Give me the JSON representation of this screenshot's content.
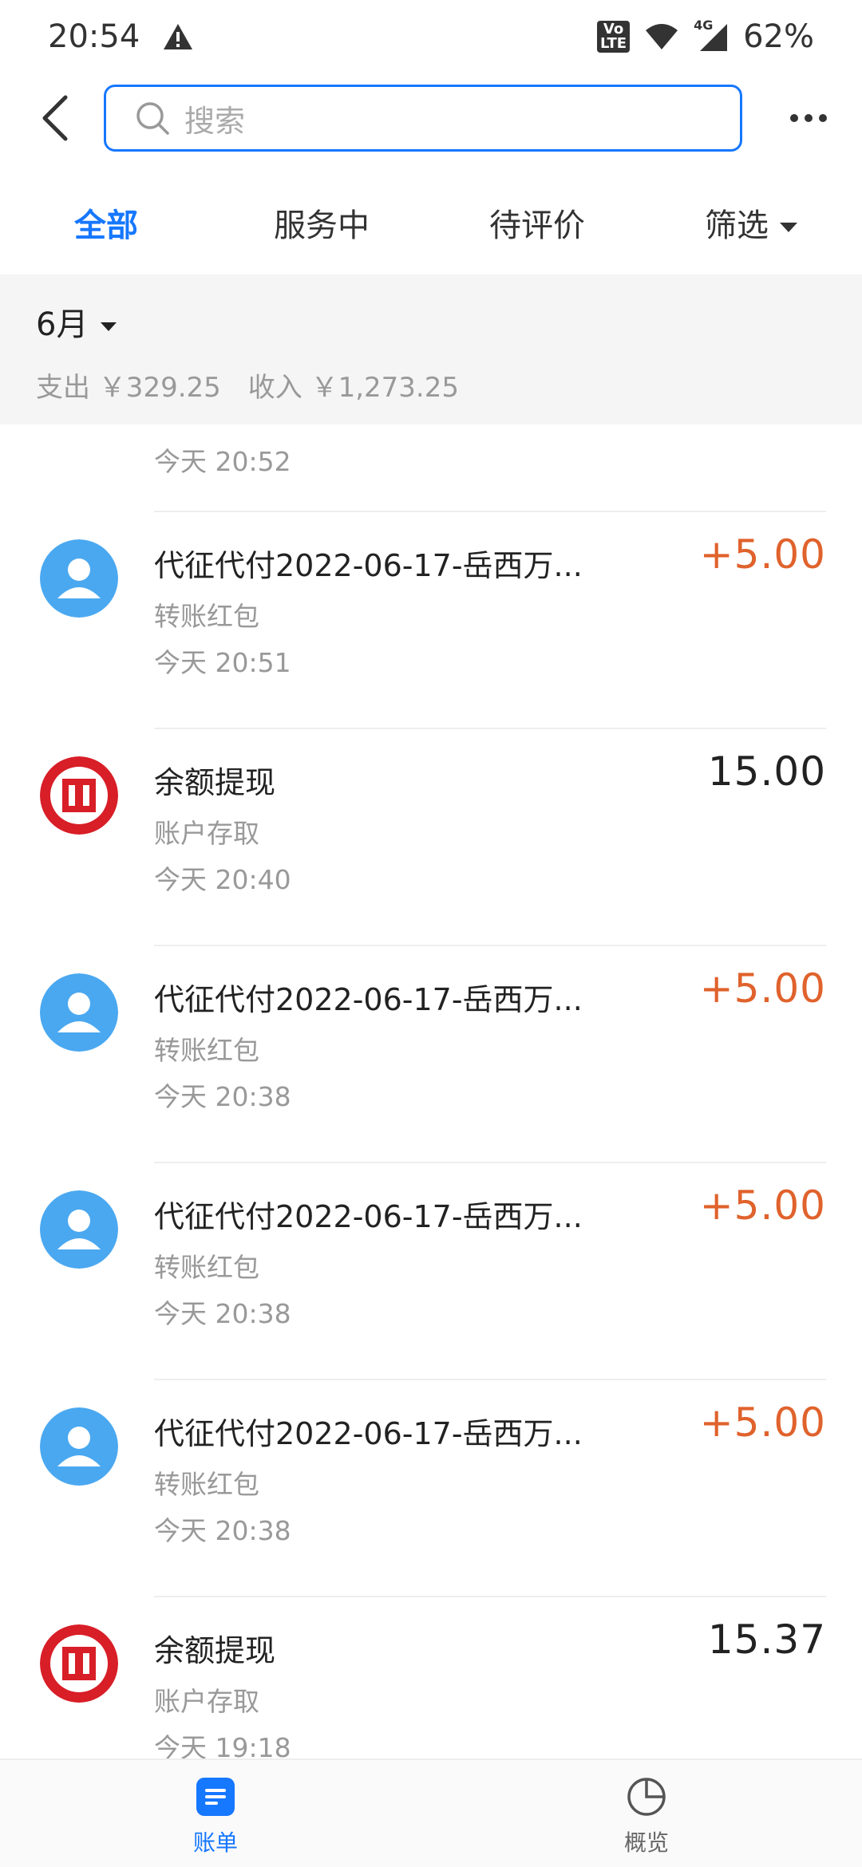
{
  "status_bar": {
    "time": "20:54",
    "volte_top": "Vo",
    "volte_bottom": "LTE",
    "network": "4G",
    "battery": "62%"
  },
  "search": {
    "placeholder": "搜索"
  },
  "tabs": [
    {
      "label": "全部",
      "active": true
    },
    {
      "label": "服务中",
      "active": false
    },
    {
      "label": "待评价",
      "active": false
    },
    {
      "label": "筛选",
      "active": false
    }
  ],
  "month": {
    "title": "6月",
    "expense": "支出 ￥329.25",
    "income": "收入 ￥1,273.25"
  },
  "partial_row_time": "今天  20:52",
  "transactions": [
    {
      "title": "代征代付2022-06-17-岳西万...",
      "subtitle": "转账红包",
      "time": "今天  20:51",
      "amount": "+5.00",
      "income": true,
      "icon": "person-avatar-icon"
    },
    {
      "title": "余额提现",
      "subtitle": "账户存取",
      "time": "今天  20:40",
      "amount": "15.00",
      "income": false,
      "icon": "icbc-bank-icon"
    },
    {
      "title": "代征代付2022-06-17-岳西万...",
      "subtitle": "转账红包",
      "time": "今天  20:38",
      "amount": "+5.00",
      "income": true,
      "icon": "person-avatar-icon"
    },
    {
      "title": "代征代付2022-06-17-岳西万...",
      "subtitle": "转账红包",
      "time": "今天  20:38",
      "amount": "+5.00",
      "income": true,
      "icon": "person-avatar-icon"
    },
    {
      "title": "代征代付2022-06-17-岳西万...",
      "subtitle": "转账红包",
      "time": "今天  20:38",
      "amount": "+5.00",
      "income": true,
      "icon": "person-avatar-icon"
    },
    {
      "title": "余额提现",
      "subtitle": "账户存取",
      "time": "今天  19:18",
      "amount": "15.37",
      "income": false,
      "icon": "icbc-bank-icon"
    }
  ],
  "bottom_nav": [
    {
      "label": "账单",
      "active": true,
      "icon": "bill-icon"
    },
    {
      "label": "概览",
      "active": false,
      "icon": "pie-chart-icon"
    }
  ],
  "colors": {
    "accent": "#1677ff",
    "income": "#e0622c",
    "avatar": "#4aa8f0",
    "bank": "#d81e27"
  }
}
